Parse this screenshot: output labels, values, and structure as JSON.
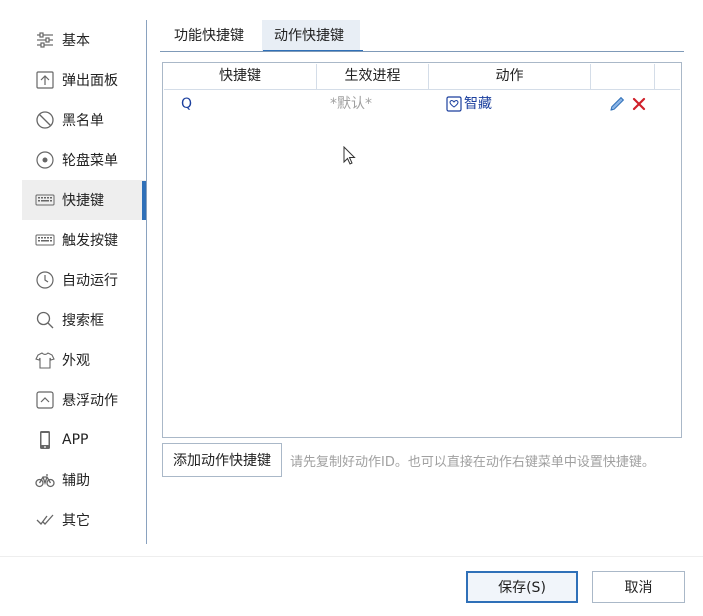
{
  "sidebar": {
    "items": [
      {
        "label": "基本",
        "icon": "sliders-icon"
      },
      {
        "label": "弹出面板",
        "icon": "popup-panel-icon"
      },
      {
        "label": "黑名单",
        "icon": "block-icon"
      },
      {
        "label": "轮盘菜单",
        "icon": "wheel-icon"
      },
      {
        "label": "快捷键",
        "icon": "keyboard-icon"
      },
      {
        "label": "触发按键",
        "icon": "keyboard-icon"
      },
      {
        "label": "自动运行",
        "icon": "clock-icon"
      },
      {
        "label": "搜索框",
        "icon": "search-icon"
      },
      {
        "label": "外观",
        "icon": "tshirt-icon"
      },
      {
        "label": "悬浮动作",
        "icon": "float-icon"
      },
      {
        "label": "APP",
        "icon": "phone-icon"
      },
      {
        "label": "辅助",
        "icon": "bike-icon"
      },
      {
        "label": "其它",
        "icon": "check-icon"
      }
    ],
    "active_index": 4
  },
  "tabs": [
    {
      "label": "功能快捷键"
    },
    {
      "label": "动作快捷键"
    }
  ],
  "active_tab": 1,
  "table": {
    "headers": [
      "快捷键",
      "生效进程",
      "动作"
    ],
    "rows": [
      {
        "key": "Q",
        "process": "*默认*",
        "action": "智藏",
        "action_icon": "action-icon"
      }
    ]
  },
  "add_button_label": "添加动作快捷键",
  "hint": "请先复制好动作ID。也可以直接在动作右键菜单中设置快捷键。",
  "footer": {
    "save_label": "保存(S)",
    "cancel_label": "取消"
  },
  "colors": {
    "accent": "#2f70b8",
    "link_text": "#1b3f9e",
    "muted_text": "#a0a0a0",
    "delete_red": "#d0202a"
  }
}
